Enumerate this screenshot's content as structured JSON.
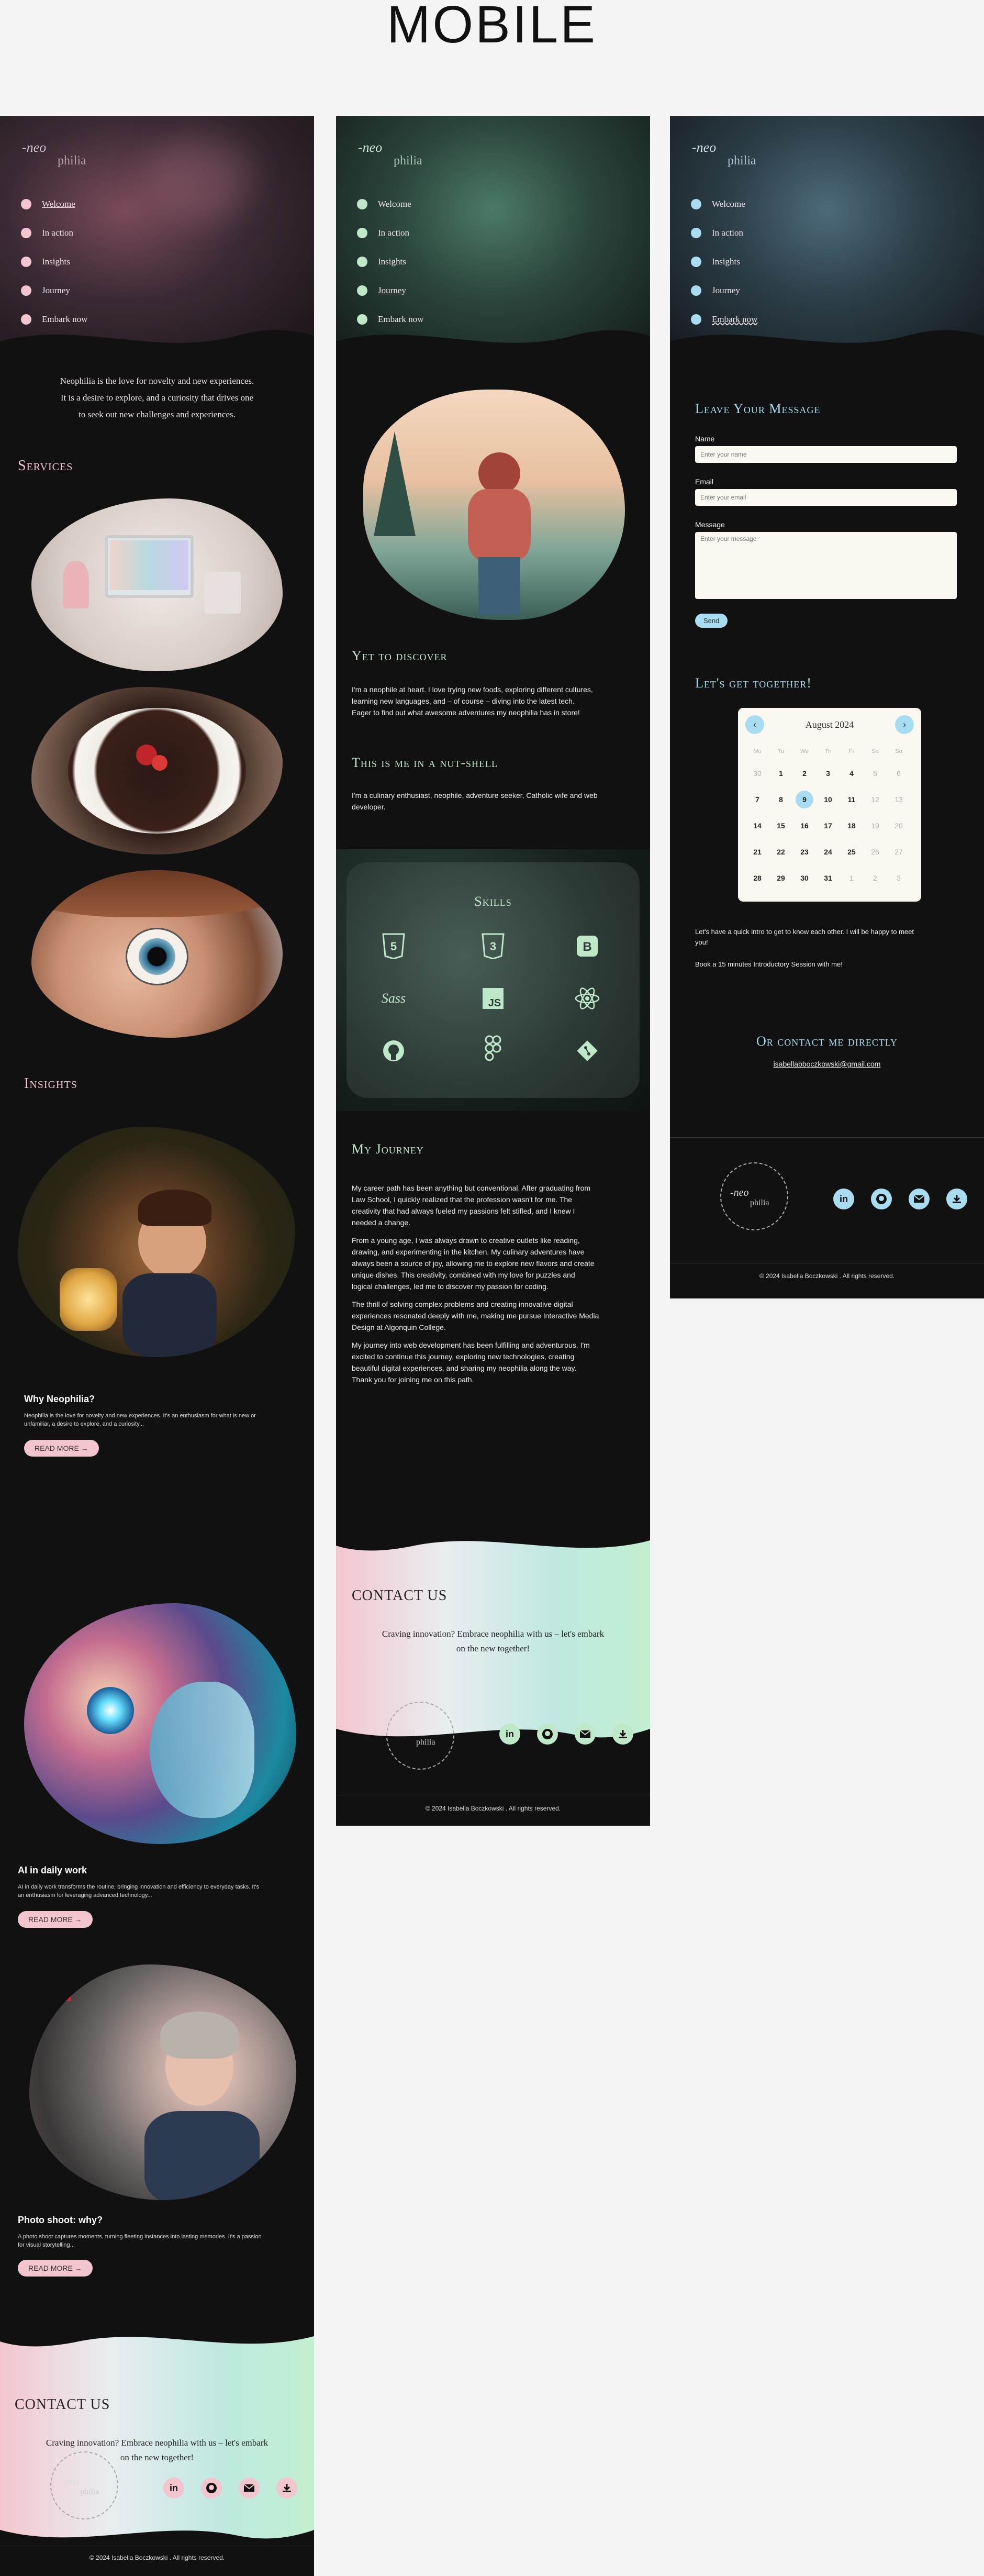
{
  "page_title": "MOBILE",
  "logo": {
    "text_top": "-neo",
    "text_bottom": "philia"
  },
  "nav": [
    "Welcome",
    "In action",
    "Insights",
    "Journey",
    "Embark now"
  ],
  "colors": {
    "pink": "#f3c6cf",
    "mint": "#bfe8c9",
    "blue": "#a8dcf0",
    "bg": "#111111"
  },
  "phone1": {
    "tagline": [
      "Neophilia is the love for novelty and new experiences.",
      "It is a desire to explore, and a curiosity that drives one",
      "to seek out new challenges and experiences."
    ],
    "services_title": "Services",
    "insights_title": "Insights",
    "insights": [
      {
        "title": "Why Neophilia?",
        "desc": [
          "Neophilia is the love for novelty and new experiences. It's an enthusiasm for what is new or",
          "unfamiliar, a desire to explore, and a curiosity..."
        ],
        "button": "READ MORE →"
      },
      {
        "title": "AI in daily work",
        "desc": [
          "AI in daily work transforms the routine, bringing innovation and efficiency to everyday tasks. It's",
          "an enthusiasm for leveraging advanced technology..."
        ],
        "button": "READ MORE →"
      },
      {
        "title": "Photo shoot: why?",
        "desc": [
          "A photo shoot captures moments, turning fleeting instances into lasting memories. It's a passion",
          "for visual storytelling..."
        ],
        "button": "READ MORE →"
      }
    ],
    "contact_title": "CONTACT US",
    "contact_text": [
      "Craving innovation? Embrace neophilia with us – let's embark",
      "on the new together!"
    ],
    "copyright": "© 2024 Isabella Boczkowski . All rights reserved."
  },
  "phone2": {
    "yet_title": "Yet to discover",
    "yet_text": [
      "I'm a neophile at heart. I love trying new foods, exploring different cultures,",
      "learning new languages, and – of course – diving into the latest tech.",
      "Eager to find out what awesome adventures my neophilia has in store!"
    ],
    "nutshell_title": "This is me in a nut-shell",
    "nutshell_text": [
      "I'm a culinary enthusiast, neophile, adventure seeker, Catholic wife and web",
      "developer."
    ],
    "skills_title": "Skills",
    "skills": [
      "html5-icon",
      "css3-icon",
      "bootstrap-icon",
      "sass-icon",
      "javascript-icon",
      "react-icon",
      "github-icon",
      "figma-icon",
      "git-icon"
    ],
    "journey_title": "My Journey",
    "journey_paragraphs": [
      [
        "My career path has been anything but conventional. After graduating from",
        "Law School, I quickly realized that the profession wasn't for me. The",
        "creativity that had always fueled my passions felt stifled, and I knew I",
        "needed a change."
      ],
      [
        "From a young age, I was always drawn to creative outlets like reading,",
        "drawing, and experimenting in the kitchen. My culinary adventures have",
        "always been a source of joy, allowing me to explore new flavors and create",
        "unique dishes. This creativity, combined with my love for puzzles and",
        "logical challenges, led me to discover my passion for coding."
      ],
      [
        "The thrill of solving complex problems and creating innovative digital",
        "experiences resonated deeply with me, making me pursue Interactive Media",
        "Design at Algonquin College."
      ],
      [
        "My journey into web development has been fulfilling and adventurous. I'm",
        "excited to continue this journey, exploring new technologies, creating",
        "beautiful digital experiences, and sharing my neophilia along the way.",
        "Thank you for joining me on this path."
      ]
    ],
    "contact_title": "CONTACT US",
    "contact_text": [
      "Craving innovation? Embrace neophilia with us – let's embark",
      "on the new together!"
    ],
    "copyright": "© 2024 Isabella Boczkowski . All rights reserved."
  },
  "phone3": {
    "message_title": "Leave Your Message",
    "name_label": "Name",
    "name_placeholder": "Enter your name",
    "email_label": "Email",
    "email_placeholder": "Enter your email",
    "message_label": "Message",
    "message_placeholder": "Enter your message",
    "send": "Send",
    "together_title": "Let's get together!",
    "calendar": {
      "month": "August 2024",
      "weekdays": [
        "Mo",
        "Tu",
        "We",
        "Th",
        "Fr",
        "Sa",
        "Su"
      ],
      "weeks": [
        [
          "30",
          "1",
          "2",
          "3",
          "4",
          "5",
          "6"
        ],
        [
          "7",
          "8",
          "9",
          "10",
          "11",
          "12",
          "13"
        ],
        [
          "14",
          "15",
          "16",
          "17",
          "18",
          "19",
          "20"
        ],
        [
          "21",
          "22",
          "23",
          "24",
          "25",
          "26",
          "27"
        ],
        [
          "28",
          "29",
          "30",
          "31",
          "1",
          "2",
          "3"
        ]
      ],
      "selected": "9"
    },
    "meet_text": [
      "Let's have a quick intro to get to know each other. I will be happy to meet",
      "you!"
    ],
    "book_text": "Book a 15 minutes Introductory Session with me!",
    "contact_direct_title": "Or contact me directly",
    "email": "isabellabboczkowski@gmail.com",
    "copyright": "© 2024 Isabella Boczkowski . All rights reserved."
  },
  "footer_icons": [
    "linkedin-icon",
    "github-icon",
    "mail-icon",
    "download-icon"
  ]
}
